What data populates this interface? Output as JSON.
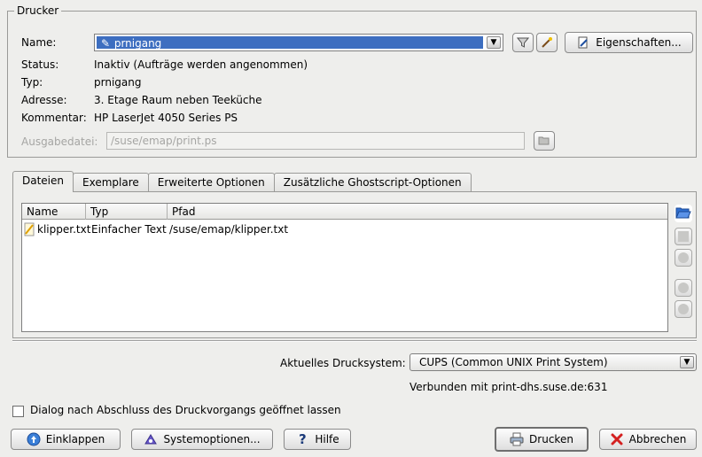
{
  "printer_group": {
    "title": "Drucker",
    "name_label": "Name:",
    "name_value": "prnigang",
    "properties_button": "Eigenschaften...",
    "status_label": "Status:",
    "status_value": "Inaktiv (Aufträge werden angenommen)",
    "type_label": "Typ:",
    "type_value": "prnigang",
    "address_label": "Adresse:",
    "address_value": "3. Etage Raum neben Teeküche",
    "comment_label": "Kommentar:",
    "comment_value": "HP LaserJet 4050 Series PS",
    "output_file_label": "Ausgabedatei:",
    "output_file_value": "/suse/emap/print.ps"
  },
  "tabs": [
    {
      "label": "Dateien"
    },
    {
      "label": "Exemplare"
    },
    {
      "label": "Erweiterte Optionen"
    },
    {
      "label": "Zusätzliche Ghostscript-Optionen"
    }
  ],
  "file_list": {
    "columns": [
      "Name",
      "Typ",
      "Pfad"
    ],
    "rows": [
      {
        "name": "klipper.txt",
        "type": "Einfacher Text",
        "path": "/suse/emap/klipper.txt"
      }
    ]
  },
  "print_system": {
    "label": "Aktuelles Drucksystem:",
    "value": "CUPS (Common UNIX Print System)",
    "connection": "Verbunden mit print-dhs.suse.de:631"
  },
  "keep_open_checkbox": {
    "label": "Dialog nach Abschluss des Druckvorgangs geöffnet lassen",
    "checked": false
  },
  "buttons": {
    "collapse": "Einklappen",
    "system_options": "Systemoptionen...",
    "help": "Hilfe",
    "print": "Drucken",
    "cancel": "Abbrechen"
  },
  "colors": {
    "selection": "#3d6ec0",
    "window_bg": "#eeeeec"
  }
}
